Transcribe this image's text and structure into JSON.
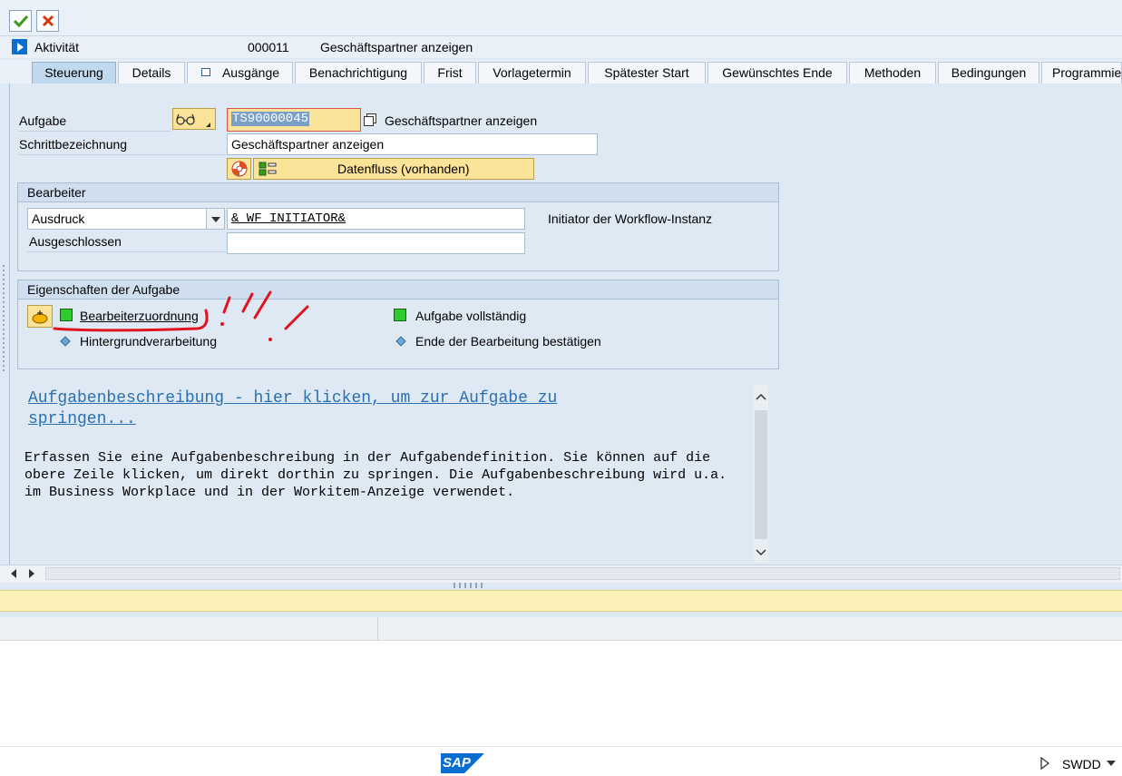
{
  "toolbar": {
    "confirm_icon": "check-icon",
    "cancel_icon": "cancel-icon"
  },
  "activity": {
    "label": "Aktivität",
    "number": "000011",
    "title": "Geschäftspartner anzeigen"
  },
  "tabs": [
    {
      "label": "Steuerung",
      "active": true
    },
    {
      "label": "Details"
    },
    {
      "label": "Ausgänge"
    },
    {
      "label": "Benachrichtigung"
    },
    {
      "label": "Frist"
    },
    {
      "label": "Vorlagetermin"
    },
    {
      "label": "Spätester Start"
    },
    {
      "label": "Gewünschtes Ende"
    },
    {
      "label": "Methoden"
    },
    {
      "label": "Bedingungen"
    },
    {
      "label": "Programmie"
    }
  ],
  "form": {
    "task_label": "Aufgabe",
    "task_value": "TS90000045",
    "task_desc": "Geschäftspartner anzeigen",
    "step_label": "Schrittbezeichnung",
    "step_value": "Geschäftspartner anzeigen",
    "dataflow_label": "Datenfluss (vorhanden)"
  },
  "agent": {
    "title": "Bearbeiter",
    "expr_type": "Ausdruck",
    "expr_value": "&_WF_INITIATOR&",
    "expr_desc": "Initiator der Workflow-Instanz",
    "excluded_label": "Ausgeschlossen",
    "excluded_value": ""
  },
  "properties": {
    "title": "Eigenschaften der Aufgabe",
    "agent_assignment": "Bearbeiterzuordnung",
    "background": "Hintergrundverarbeitung",
    "task_complete": "Aufgabe vollständig",
    "confirm_end": "Ende der Bearbeitung bestätigen"
  },
  "description": {
    "link_text": "Aufgabenbeschreibung - hier klicken, um zur Aufgabe zu springen...",
    "body": "Erfassen Sie eine Aufgabenbeschreibung in der Aufgabendefinition. Sie können auf die obere Zeile klicken, um direkt dorthin zu springen. Die Aufgabenbeschreibung wird u.a. im Business Workplace und in der Workitem-Anzeige verwendet."
  },
  "footer": {
    "logo": "SAP",
    "transaction": "SWDD"
  },
  "colors": {
    "accent": "#0a6ed1",
    "status_green": "#2ecc2e",
    "annotation_red": "#e0141e",
    "button_yellow": "#fbe49a"
  }
}
